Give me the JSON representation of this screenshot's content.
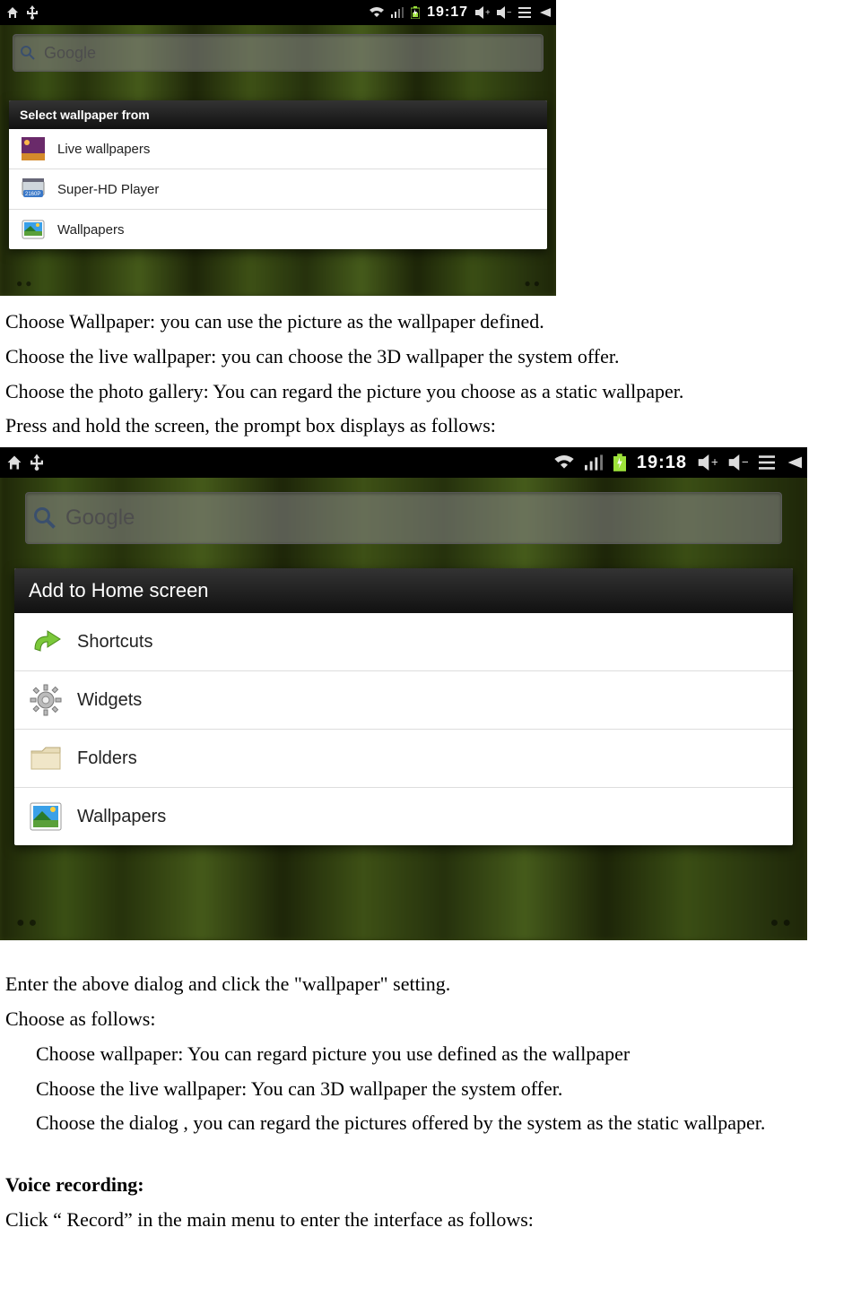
{
  "screenshot1": {
    "statusbar_time": "19:17",
    "search_placeholder": "Google",
    "dialog_title": "Select wallpaper from",
    "items": [
      {
        "label": "Live wallpapers"
      },
      {
        "label": "Super-HD Player"
      },
      {
        "label": "Wallpapers"
      }
    ]
  },
  "text1": {
    "l1": "Choose Wallpaper: you can use the picture as the wallpaper defined.",
    "l2": "Choose the live wallpaper: you can choose the 3D wallpaper the system offer.",
    "l3": "Choose the photo gallery: You can regard the picture you choose as a static wallpaper.",
    "l4": "Press and hold the screen, the prompt box displays as follows:"
  },
  "screenshot2": {
    "statusbar_time": "19:18",
    "search_placeholder": "Google",
    "dialog_title": "Add to Home screen",
    "items": [
      {
        "label": "Shortcuts"
      },
      {
        "label": "Widgets"
      },
      {
        "label": "Folders"
      },
      {
        "label": "Wallpapers"
      }
    ]
  },
  "text2": {
    "l1": "Enter the above dialog and click the \"wallpaper\" setting.",
    "l2": "Choose as follows:",
    "l3": "Choose wallpaper: You can regard picture you use defined as the wallpaper",
    "l4": "Choose the live wallpaper: You can 3D wallpaper the system offer.",
    "l5": "Choose the dialog , you can regard the pictures offered by the system as the static wallpaper."
  },
  "text3": {
    "heading": "Voice recording:",
    "l1": "Click “ Record” in the main menu to enter the interface as follows:"
  }
}
